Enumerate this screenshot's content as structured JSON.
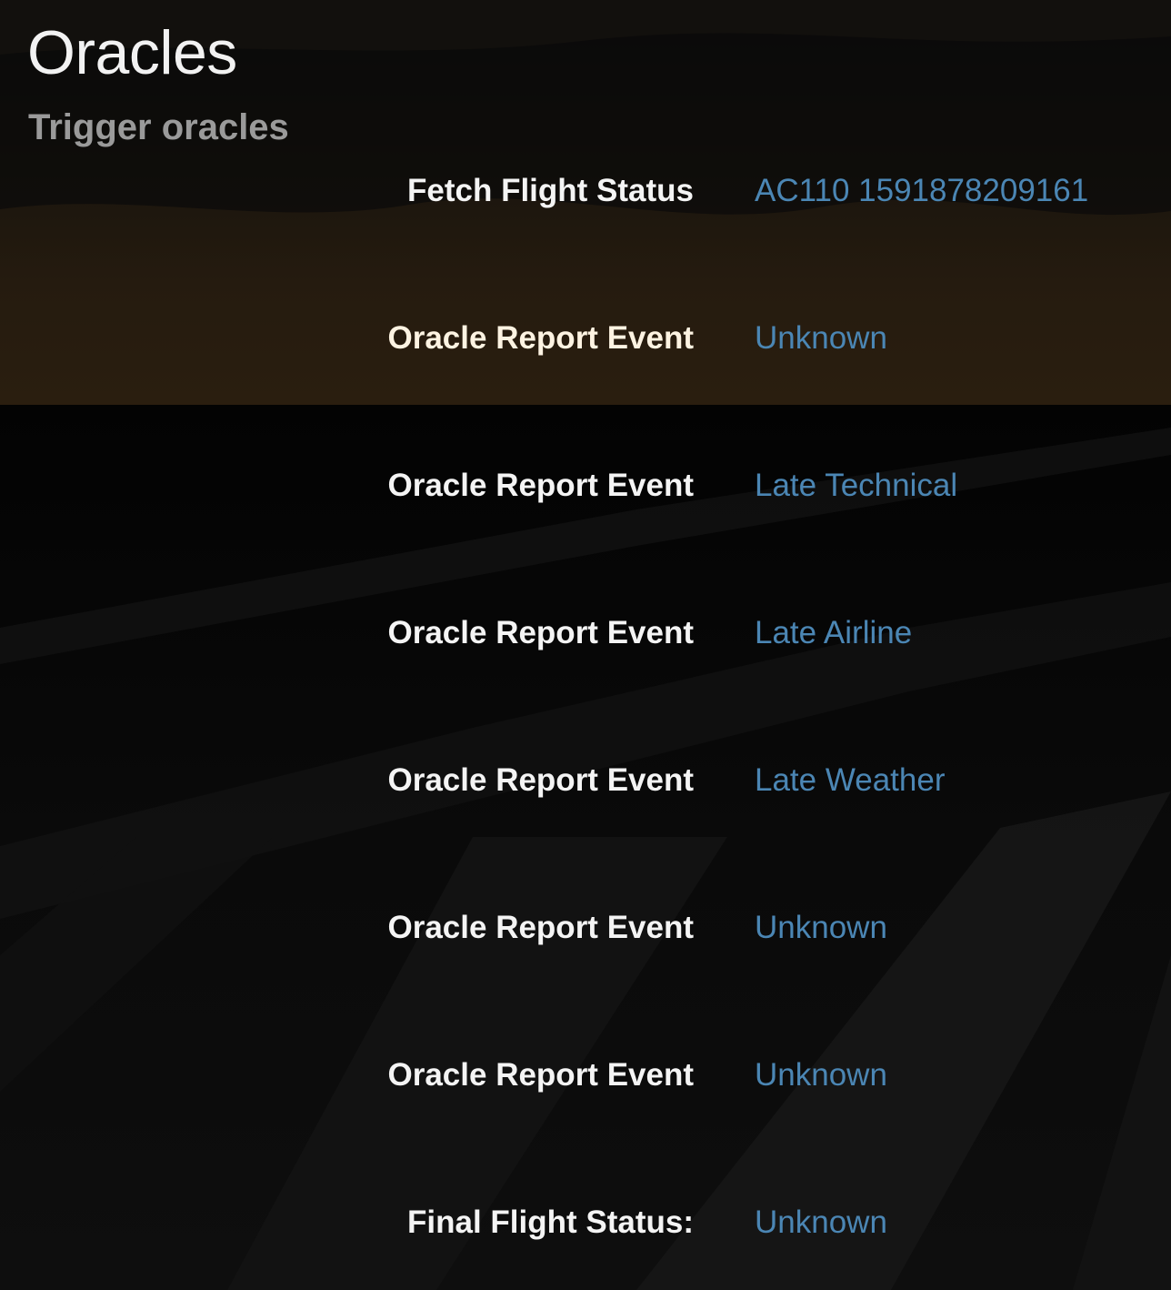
{
  "header": {
    "title": "Oracles",
    "subtitle": "Trigger oracles"
  },
  "colors": {
    "background": "#050505",
    "label_text": "#f4f4f4",
    "link_text": "#4b86b4",
    "subtitle_text": "#9a9a9a",
    "sunset_glow": "#2a1f10"
  },
  "background_image": "airport-runway-at-dusk",
  "rows": [
    {
      "label": "Fetch Flight Status",
      "value": "AC110 1591878209161"
    },
    {
      "label": "Oracle Report Event",
      "value": "Unknown"
    },
    {
      "label": "Oracle Report Event",
      "value": "Late Technical"
    },
    {
      "label": "Oracle Report Event",
      "value": "Late Airline"
    },
    {
      "label": "Oracle Report Event",
      "value": "Late Weather"
    },
    {
      "label": "Oracle Report Event",
      "value": "Unknown"
    },
    {
      "label": "Oracle Report Event",
      "value": "Unknown"
    },
    {
      "label": "Final Flight Status:",
      "value": "Unknown"
    }
  ]
}
